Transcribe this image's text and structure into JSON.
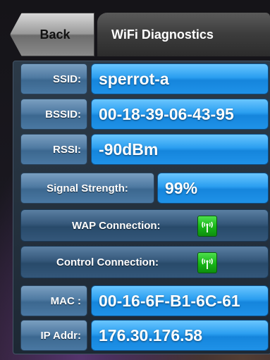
{
  "header": {
    "back_label": "Back",
    "title": "WiFi Diagnostics"
  },
  "fields": {
    "ssid": {
      "label": "SSID:",
      "value": "sperrot-a"
    },
    "bssid": {
      "label": "BSSID:",
      "value": "00-18-39-06-43-95"
    },
    "rssi": {
      "label": "RSSI:",
      "value": "-90dBm"
    },
    "signal_strength": {
      "label": "Signal Strength:",
      "value": "99%"
    },
    "wap_connection": {
      "label": "WAP Connection:",
      "icon": "wifi-antenna-green-icon",
      "status_color": "#18b818"
    },
    "control_connection": {
      "label": "Control Connection:",
      "icon": "wifi-antenna-green-icon",
      "status_color": "#18b818"
    },
    "mac": {
      "label": "MAC :",
      "value": "00-16-6F-B1-6C-61"
    },
    "ip_addr": {
      "label": "IP Addr:",
      "value": "176.30.176.58"
    }
  },
  "colors": {
    "value_blue": "#2a9ef0",
    "label_blue": "#4f7aa2",
    "status_green": "#18b818"
  }
}
